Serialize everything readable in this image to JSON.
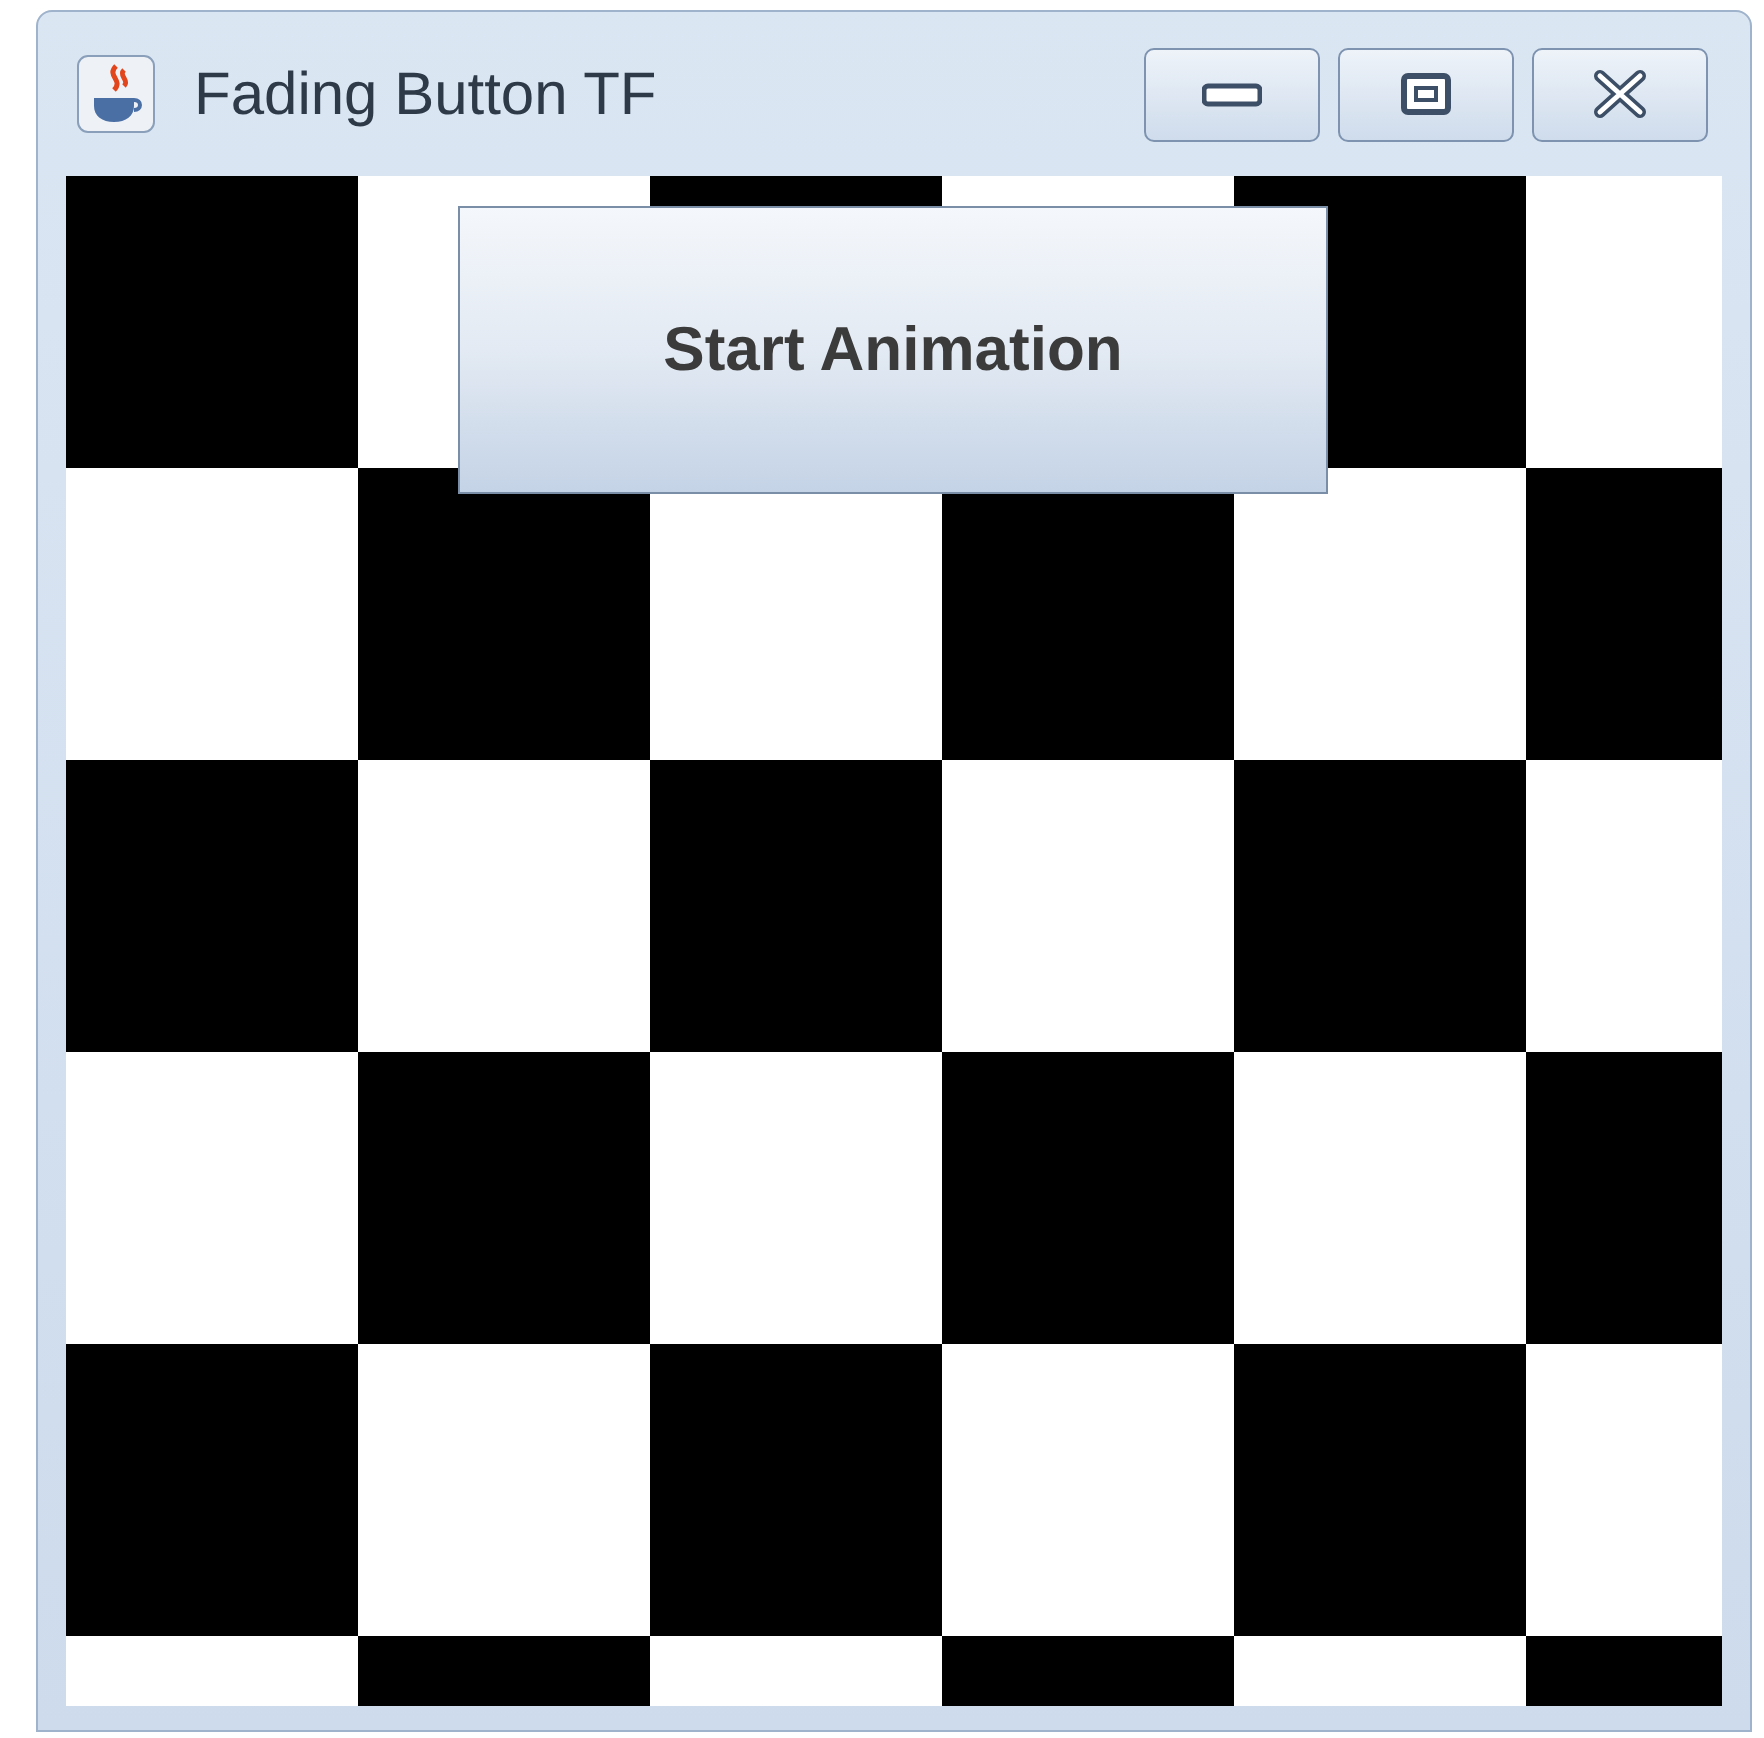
{
  "window": {
    "title": "Fading Button TF"
  },
  "button": {
    "label": "Start Animation"
  }
}
